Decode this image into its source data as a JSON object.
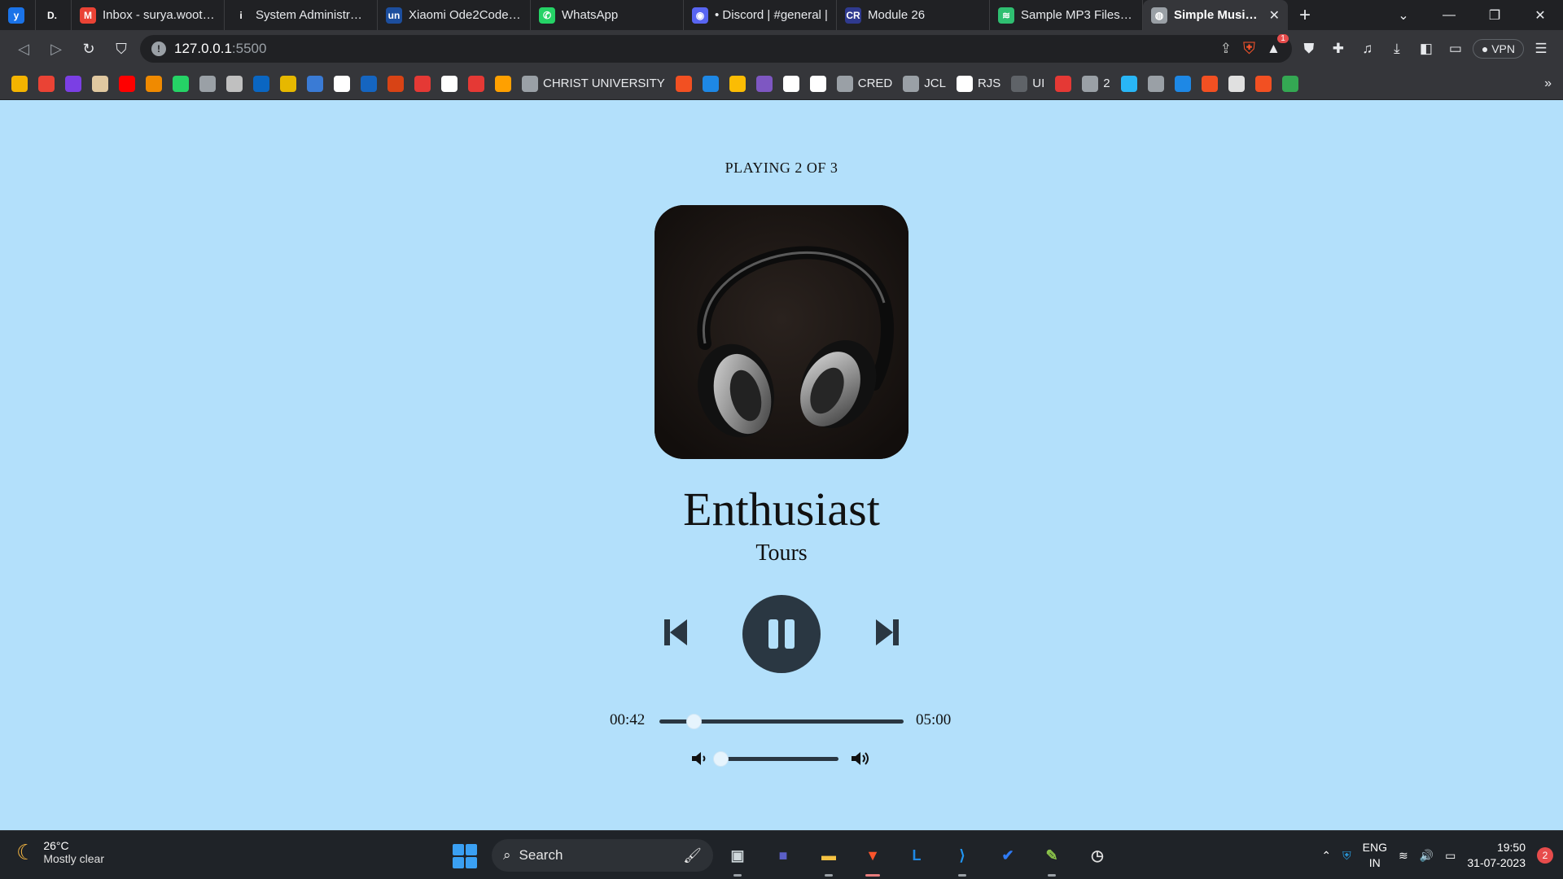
{
  "browser": {
    "tabs": [
      {
        "title": "",
        "icon": "y-app-icon",
        "color": "#1a73e8",
        "glyph": "y"
      },
      {
        "title": "",
        "icon": "d-app-icon",
        "color": "#ffffff",
        "glyph": "D."
      },
      {
        "title": "Inbox - surya.woot.23",
        "icon": "gmail-icon",
        "color": "#ea4335",
        "glyph": "M"
      },
      {
        "title": "System Administrator",
        "icon": "info-icon",
        "color": "#ffffff",
        "glyph": "i"
      },
      {
        "title": "Xiaomi Ode2Code 3.0",
        "icon": "unstop-icon",
        "color": "#1c4e9e",
        "glyph": "un"
      },
      {
        "title": "WhatsApp",
        "icon": "whatsapp-icon",
        "color": "#25d366",
        "glyph": "✆"
      },
      {
        "title": "• Discord | #general |",
        "icon": "discord-icon",
        "color": "#5865f2",
        "glyph": "◉"
      },
      {
        "title": "Module 26",
        "icon": "cr-icon",
        "color": "#2f3a8f",
        "glyph": "CR"
      },
      {
        "title": "Sample MP3 Files Do",
        "icon": "layers-icon",
        "color": "#2fbf71",
        "glyph": "≋"
      },
      {
        "title": "Simple Music P",
        "icon": "globe-icon",
        "color": "#9aa0a6",
        "glyph": "◍"
      }
    ],
    "active_tab_index": 9,
    "address": {
      "host": "127.0.0.1",
      "port": ":5500"
    },
    "vpn_label": "VPN",
    "brave_badge": "1",
    "bookmarks": [
      {
        "label": "",
        "color": "#f4b400"
      },
      {
        "label": "",
        "color": "#ea4335"
      },
      {
        "label": "",
        "color": "#7b3fe4"
      },
      {
        "label": "",
        "color": "#e0c8a0"
      },
      {
        "label": "",
        "color": "#ff0000"
      },
      {
        "label": "",
        "color": "#f08a00"
      },
      {
        "label": "",
        "color": "#25d366"
      },
      {
        "label": "",
        "color": "#9aa0a6"
      },
      {
        "label": "",
        "color": "#c0c0c0"
      },
      {
        "label": "",
        "color": "#0a66c2"
      },
      {
        "label": "",
        "color": "#e6b800"
      },
      {
        "label": "",
        "color": "#3a7bd5"
      },
      {
        "label": "",
        "color": "#ffffff"
      },
      {
        "label": "",
        "color": "#1565c0"
      },
      {
        "label": "",
        "color": "#d84315"
      },
      {
        "label": "",
        "color": "#e53935"
      },
      {
        "label": "",
        "color": "#ffffff"
      },
      {
        "label": "",
        "color": "#e53935"
      },
      {
        "label": "",
        "color": "#ffa000"
      },
      {
        "label": "CHRIST UNIVERSITY",
        "color": "#9aa0a6"
      },
      {
        "label": "",
        "color": "#f25022"
      },
      {
        "label": "",
        "color": "#1e88e5"
      },
      {
        "label": "",
        "color": "#fbbc04"
      },
      {
        "label": "",
        "color": "#7e57c2"
      },
      {
        "label": "",
        "color": "#ffffff"
      },
      {
        "label": "",
        "color": "#ffffff"
      },
      {
        "label": "CRED",
        "color": "#9aa0a6"
      },
      {
        "label": "JCL",
        "color": "#9aa0a6"
      },
      {
        "label": "RJS",
        "color": "#ffffff"
      },
      {
        "label": "UI",
        "color": "#5f6368"
      },
      {
        "label": "",
        "color": "#e53935"
      },
      {
        "label": "2",
        "color": "#9aa0a6"
      },
      {
        "label": "",
        "color": "#29b6f6"
      },
      {
        "label": "",
        "color": "#9aa0a6"
      },
      {
        "label": "",
        "color": "#1e88e5"
      },
      {
        "label": "",
        "color": "#f25022"
      },
      {
        "label": "",
        "color": "#e0e0e0"
      },
      {
        "label": "",
        "color": "#f25022"
      },
      {
        "label": "",
        "color": "#34a853"
      }
    ]
  },
  "player": {
    "now_playing": "PLAYING 2 OF 3",
    "title": "Enthusiast",
    "artist": "Tours",
    "time_current": "00:42",
    "time_total": "05:00",
    "progress_fraction": 0.14,
    "volume_fraction": 0.02,
    "state": "playing",
    "colors": {
      "background": "#b3e0fb",
      "controls": "#2a3742"
    }
  },
  "taskbar": {
    "weather_temp": "26°C",
    "weather_condition": "Mostly clear",
    "search_label": "Search",
    "apps": [
      {
        "name": "task-view",
        "color": "#cfd8dc",
        "glyph": "▣"
      },
      {
        "name": "meet",
        "color": "#5b5fc7",
        "glyph": "■"
      },
      {
        "name": "file-explorer",
        "color": "#f6c343",
        "glyph": "▬"
      },
      {
        "name": "brave",
        "color": "#fb542b",
        "glyph": "▼"
      },
      {
        "name": "l-app",
        "color": "#1e88e5",
        "glyph": "L"
      },
      {
        "name": "vscode",
        "color": "#2196f3",
        "glyph": "⟩"
      },
      {
        "name": "todo",
        "color": "#2f7bf5",
        "glyph": "✔"
      },
      {
        "name": "notepad",
        "color": "#8bc34a",
        "glyph": "✎"
      },
      {
        "name": "clock-app",
        "color": "#e0e0e0",
        "glyph": "◷"
      }
    ],
    "language": "ENG",
    "region": "IN",
    "time": "19:50",
    "date": "31-07-2023",
    "notification_count": "2"
  }
}
